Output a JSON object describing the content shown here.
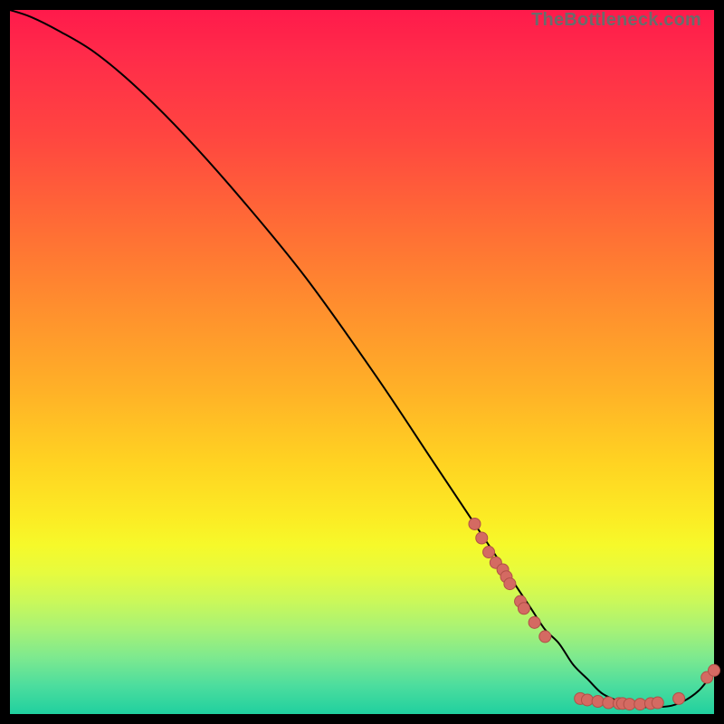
{
  "watermark": "TheBottleneck.com",
  "colors": {
    "line": "#000000",
    "dot_fill": "#d46a62",
    "dot_stroke": "#b15048"
  },
  "chart_data": {
    "type": "line",
    "title": "",
    "xlabel": "",
    "ylabel": "",
    "xlim": [
      0,
      100
    ],
    "ylim": [
      0,
      100
    ],
    "grid": false,
    "legend": false,
    "note": "Bottleneck-style curve. X axis ≈ component score; Y axis ≈ bottleneck %. Curve descends from 100% at x=0 to ~0% in the ~80–95 range, then rises slightly near x=100.",
    "series": [
      {
        "name": "bottleneck-curve",
        "x": [
          0,
          3,
          7,
          12,
          18,
          25,
          33,
          42,
          52,
          60,
          66,
          70,
          72,
          74,
          76,
          78,
          80,
          82,
          84,
          86,
          88,
          90,
          92,
          94,
          96,
          98,
          100
        ],
        "y": [
          100,
          99,
          97,
          94,
          89,
          82,
          73,
          62,
          48,
          36,
          27,
          21,
          18,
          15,
          12,
          10,
          7,
          5,
          3,
          2,
          1.2,
          1,
          1,
          1.2,
          2,
          3.5,
          6
        ]
      }
    ],
    "scatter": [
      {
        "x": 66,
        "y": 27
      },
      {
        "x": 67,
        "y": 25
      },
      {
        "x": 68,
        "y": 23
      },
      {
        "x": 69,
        "y": 21.5
      },
      {
        "x": 70,
        "y": 20.5
      },
      {
        "x": 70.5,
        "y": 19.5
      },
      {
        "x": 71,
        "y": 18.5
      },
      {
        "x": 72.5,
        "y": 16
      },
      {
        "x": 73,
        "y": 15
      },
      {
        "x": 74.5,
        "y": 13
      },
      {
        "x": 76,
        "y": 11
      },
      {
        "x": 81,
        "y": 2.2
      },
      {
        "x": 82,
        "y": 2.0
      },
      {
        "x": 83.5,
        "y": 1.8
      },
      {
        "x": 85,
        "y": 1.6
      },
      {
        "x": 86.5,
        "y": 1.5
      },
      {
        "x": 87,
        "y": 1.5
      },
      {
        "x": 88,
        "y": 1.4
      },
      {
        "x": 89.5,
        "y": 1.4
      },
      {
        "x": 91,
        "y": 1.5
      },
      {
        "x": 92,
        "y": 1.6
      },
      {
        "x": 95,
        "y": 2.2
      },
      {
        "x": 99,
        "y": 5.2
      },
      {
        "x": 100,
        "y": 6.2
      }
    ]
  }
}
